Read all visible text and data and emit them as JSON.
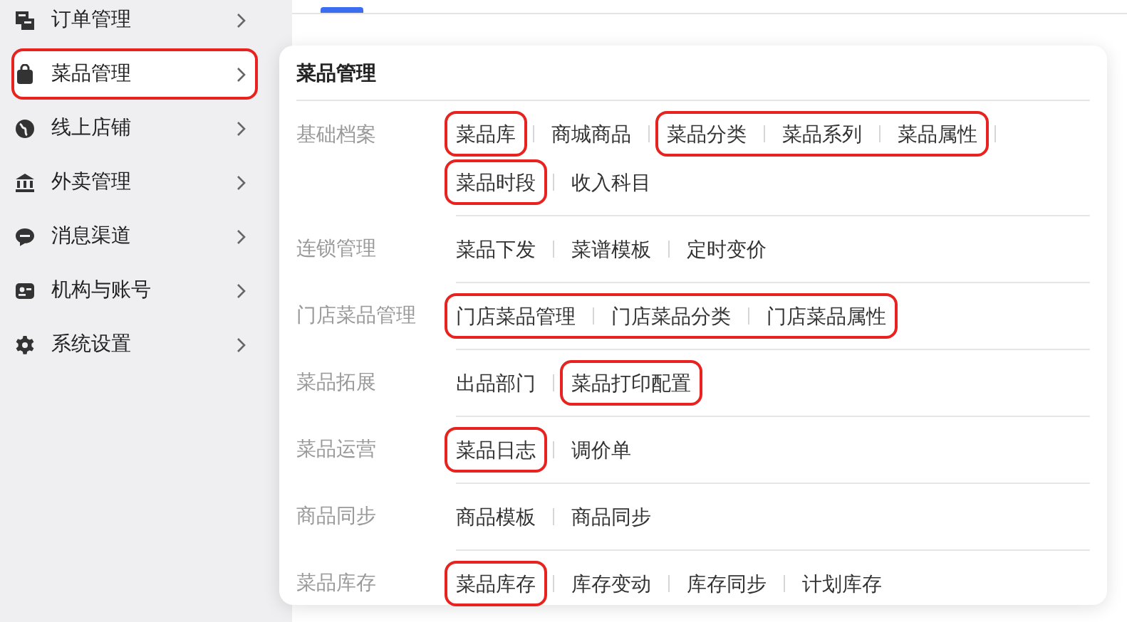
{
  "sidebar": {
    "items": [
      {
        "label": "订单管理",
        "selected": false,
        "highlighted": false
      },
      {
        "label": "菜品管理",
        "selected": true,
        "highlighted": true
      },
      {
        "label": "线上店铺",
        "selected": false,
        "highlighted": false
      },
      {
        "label": "外卖管理",
        "selected": false,
        "highlighted": false
      },
      {
        "label": "消息渠道",
        "selected": false,
        "highlighted": false
      },
      {
        "label": "机构与账号",
        "selected": false,
        "highlighted": false
      },
      {
        "label": "系统设置",
        "selected": false,
        "highlighted": false
      }
    ]
  },
  "popup": {
    "title": "菜品管理",
    "groups": [
      {
        "label": "基础档案",
        "lines": [
          [
            {
              "label": "菜品库",
              "highlighted": true
            },
            {
              "label": "商城商品",
              "highlighted": false
            },
            {
              "label": "菜品分类",
              "highlighted": true
            },
            {
              "label": "菜品系列",
              "highlighted": true
            },
            {
              "label": "菜品属性",
              "highlighted": true
            }
          ],
          [
            {
              "label": "菜品时段",
              "highlighted": true
            },
            {
              "label": "收入科目",
              "highlighted": false
            }
          ]
        ]
      },
      {
        "label": "连锁管理",
        "lines": [
          [
            {
              "label": "菜品下发",
              "highlighted": false
            },
            {
              "label": "菜谱模板",
              "highlighted": false
            },
            {
              "label": "定时变价",
              "highlighted": false
            }
          ]
        ]
      },
      {
        "label": "门店菜品管理",
        "lines": [
          [
            {
              "label": "门店菜品管理",
              "highlighted": true
            },
            {
              "label": "门店菜品分类",
              "highlighted": true
            },
            {
              "label": "门店菜品属性",
              "highlighted": true
            }
          ]
        ]
      },
      {
        "label": "菜品拓展",
        "lines": [
          [
            {
              "label": "出品部门",
              "highlighted": false
            },
            {
              "label": "菜品打印配置",
              "highlighted": true
            }
          ]
        ]
      },
      {
        "label": "菜品运营",
        "lines": [
          [
            {
              "label": "菜品日志",
              "highlighted": true
            },
            {
              "label": "调价单",
              "highlighted": false
            }
          ]
        ]
      },
      {
        "label": "商品同步",
        "lines": [
          [
            {
              "label": "商品模板",
              "highlighted": false
            },
            {
              "label": "商品同步",
              "highlighted": false
            }
          ]
        ]
      },
      {
        "label": "菜品库存",
        "lines": [
          [
            {
              "label": "菜品库存",
              "highlighted": true
            },
            {
              "label": "库存变动",
              "highlighted": false
            },
            {
              "label": "库存同步",
              "highlighted": false
            },
            {
              "label": "计划库存",
              "highlighted": false
            }
          ]
        ]
      }
    ]
  }
}
